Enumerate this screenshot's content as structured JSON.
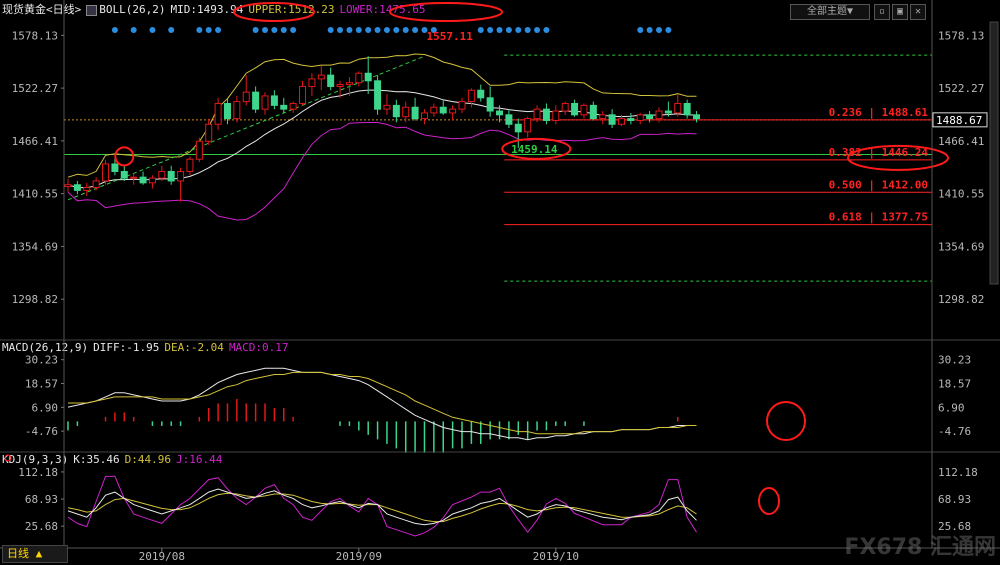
{
  "colors": {
    "bg": "#000000",
    "up": "#e01818",
    "down": "#3dd68c",
    "mid": "#e8e8e8",
    "upper": "#d4c23a",
    "lower": "#cc22cc",
    "diff": "#e8e8e8",
    "dea": "#d4c23a",
    "kdj_k": "#e8e8e8",
    "kdj_d": "#d4c23a",
    "kdj_j": "#cc22cc",
    "fib": "#ff2222",
    "support": "#2ecc40",
    "annot": "#ff1a1a",
    "axis": "#b8b8b8"
  },
  "header": {
    "symbol": "现货黄金",
    "period_tag": "<日线>",
    "indicator_icon": "chart-icon",
    "boll_name": "BOLL(26,2)",
    "mid": "MID:1493.94",
    "upper": "UPPER:1512.23",
    "lower": "LOWER:1475.65"
  },
  "macd_header": {
    "name": "MACD(26,12,9)",
    "diff": "DIFF:-1.95",
    "dea": "DEA:-2.04",
    "macd": "MACD:0.17"
  },
  "kdj_header": {
    "name": "KDJ(9,3,3)",
    "k": "K:35.46",
    "d": "D:44.96",
    "j": "J:16.44"
  },
  "toolbar": {
    "theme_label": "全部主题▼"
  },
  "period_button": "日线 ▲",
  "watermark": "FX678 汇通网",
  "chart_data": [
    {
      "type": "candlestick",
      "title": "现货黄金 <日线>",
      "y_ticks": [
        "1578.13",
        "1522.27",
        "1466.41",
        "1410.55",
        "1354.69",
        "1298.82"
      ],
      "ylim": [
        1262.0,
        1588.0
      ],
      "x_labels": [
        {
          "label": "2019/08",
          "index": 10
        },
        {
          "label": "2019/09",
          "index": 31
        },
        {
          "label": "2019/10",
          "index": 52
        }
      ],
      "ohlc": [
        [
          1418,
          1426,
          1412,
          1420
        ],
        [
          1420,
          1424,
          1410,
          1414
        ],
        [
          1414,
          1422,
          1408,
          1417
        ],
        [
          1417,
          1428,
          1414,
          1424
        ],
        [
          1424,
          1446,
          1420,
          1442
        ],
        [
          1442,
          1448,
          1430,
          1434
        ],
        [
          1434,
          1440,
          1424,
          1427
        ],
        [
          1427,
          1432,
          1420,
          1428
        ],
        [
          1428,
          1434,
          1420,
          1422
        ],
        [
          1422,
          1430,
          1416,
          1427
        ],
        [
          1427,
          1440,
          1424,
          1434
        ],
        [
          1434,
          1440,
          1420,
          1424
        ],
        [
          1424,
          1438,
          1402,
          1434
        ],
        [
          1434,
          1450,
          1430,
          1447
        ],
        [
          1447,
          1470,
          1444,
          1466
        ],
        [
          1466,
          1490,
          1462,
          1484
        ],
        [
          1484,
          1512,
          1478,
          1506
        ],
        [
          1506,
          1512,
          1484,
          1490
        ],
        [
          1490,
          1514,
          1486,
          1508
        ],
        [
          1508,
          1536,
          1504,
          1518
        ],
        [
          1518,
          1524,
          1496,
          1500
        ],
        [
          1500,
          1518,
          1494,
          1514
        ],
        [
          1514,
          1520,
          1500,
          1504
        ],
        [
          1504,
          1512,
          1496,
          1500
        ],
        [
          1500,
          1508,
          1496,
          1506
        ],
        [
          1506,
          1530,
          1504,
          1524
        ],
        [
          1524,
          1538,
          1514,
          1532
        ],
        [
          1532,
          1546,
          1520,
          1536
        ],
        [
          1536,
          1544,
          1520,
          1524
        ],
        [
          1524,
          1530,
          1512,
          1526
        ],
        [
          1526,
          1534,
          1514,
          1528
        ],
        [
          1528,
          1540,
          1524,
          1538
        ],
        [
          1538,
          1556,
          1516,
          1530
        ],
        [
          1530,
          1536,
          1494,
          1500
        ],
        [
          1500,
          1516,
          1494,
          1504
        ],
        [
          1504,
          1510,
          1486,
          1492
        ],
        [
          1492,
          1508,
          1486,
          1502
        ],
        [
          1502,
          1512,
          1488,
          1490
        ],
        [
          1490,
          1500,
          1484,
          1496
        ],
        [
          1496,
          1506,
          1492,
          1502
        ],
        [
          1502,
          1510,
          1494,
          1496
        ],
        [
          1496,
          1504,
          1488,
          1500
        ],
        [
          1500,
          1512,
          1496,
          1508
        ],
        [
          1508,
          1522,
          1502,
          1520
        ],
        [
          1520,
          1526,
          1508,
          1512
        ],
        [
          1512,
          1524,
          1492,
          1498
        ],
        [
          1498,
          1504,
          1486,
          1494
        ],
        [
          1494,
          1500,
          1480,
          1484
        ],
        [
          1484,
          1490,
          1459,
          1476
        ],
        [
          1476,
          1492,
          1470,
          1490
        ],
        [
          1490,
          1504,
          1486,
          1500
        ],
        [
          1500,
          1506,
          1484,
          1488
        ],
        [
          1488,
          1504,
          1484,
          1498
        ],
        [
          1498,
          1508,
          1494,
          1506
        ],
        [
          1506,
          1510,
          1492,
          1494
        ],
        [
          1494,
          1506,
          1490,
          1504
        ],
        [
          1504,
          1508,
          1488,
          1490
        ],
        [
          1490,
          1498,
          1484,
          1494
        ],
        [
          1494,
          1500,
          1480,
          1484
        ],
        [
          1484,
          1494,
          1482,
          1490
        ],
        [
          1490,
          1496,
          1484,
          1488
        ],
        [
          1488,
          1496,
          1484,
          1494
        ],
        [
          1494,
          1498,
          1486,
          1490
        ],
        [
          1490,
          1502,
          1486,
          1498
        ],
        [
          1498,
          1508,
          1492,
          1496
        ],
        [
          1496,
          1516,
          1492,
          1506
        ],
        [
          1506,
          1510,
          1490,
          1494
        ],
        [
          1494,
          1498,
          1486,
          1490
        ]
      ],
      "annotations": {
        "peak_label": "1557.11",
        "low_label": "1459.14",
        "fib_levels": [
          {
            "ratio": "0.236",
            "price": 1488.61,
            "label": "0.236 | 1488.61"
          },
          {
            "ratio": "0.382",
            "price": 1446.24,
            "label": "0.382 | 1446.24"
          },
          {
            "ratio": "0.500",
            "price": 1412.0,
            "label": "0.500 | 1412.00"
          },
          {
            "ratio": "0.618",
            "price": 1377.75,
            "label": "0.618 | 1377.75"
          }
        ],
        "top_guide": 1557.11,
        "bottom_guide": 1318.0,
        "support": 1452.0,
        "current_price": "1488.67"
      }
    },
    {
      "type": "line",
      "title": "MACD(26,12,9)",
      "y_ticks": [
        "30.23",
        "18.57",
        "6.90",
        "-4.76"
      ],
      "ylim": [
        -14.0,
        34.0
      ],
      "series": [
        {
          "name": "DIFF",
          "values": [
            7,
            8,
            9,
            10,
            12,
            14,
            14,
            13,
            12,
            11,
            10,
            10,
            10,
            11,
            13,
            16,
            19,
            21,
            23,
            24,
            25,
            26,
            26,
            26,
            25,
            24,
            24,
            24,
            23,
            22,
            21,
            20,
            18,
            15,
            12,
            9,
            6,
            3,
            1,
            -1,
            -3,
            -4,
            -5,
            -5,
            -6,
            -6,
            -7,
            -8,
            -8,
            -9,
            -8,
            -8,
            -7,
            -7,
            -6,
            -6,
            -5,
            -5,
            -5,
            -4,
            -4,
            -4,
            -4,
            -3,
            -3,
            -2,
            -2,
            -2
          ]
        },
        {
          "name": "DEA",
          "values": [
            9,
            9,
            9,
            10,
            11,
            12,
            12,
            12,
            12,
            12,
            11,
            11,
            11,
            11,
            12,
            13,
            15,
            17,
            18,
            20,
            21,
            22,
            23,
            23,
            24,
            24,
            24,
            24,
            23,
            23,
            22,
            22,
            21,
            19,
            17,
            15,
            13,
            10,
            8,
            6,
            4,
            2,
            1,
            0,
            -1,
            -2,
            -3,
            -4,
            -5,
            -5,
            -6,
            -6,
            -6,
            -6,
            -6,
            -5,
            -5,
            -5,
            -5,
            -4,
            -4,
            -4,
            -4,
            -3,
            -3,
            -3,
            -2,
            -2
          ]
        },
        {
          "name": "MACD",
          "values": [
            -2,
            -1,
            0,
            0,
            1,
            2,
            2,
            1,
            0,
            -1,
            -1,
            -1,
            -1,
            0,
            1,
            3,
            4,
            4,
            5,
            4,
            4,
            4,
            3,
            3,
            1,
            0,
            0,
            0,
            0,
            -1,
            -1,
            -2,
            -3,
            -4,
            -5,
            -6,
            -7,
            -7,
            -7,
            -7,
            -7,
            -6,
            -6,
            -5,
            -5,
            -4,
            -4,
            -4,
            -3,
            -4,
            -2,
            -2,
            -1,
            -1,
            0,
            -1,
            0,
            0,
            0,
            0,
            0,
            0,
            0,
            0,
            0,
            1,
            0,
            0
          ]
        }
      ]
    },
    {
      "type": "line",
      "title": "KDJ(9,3,3)",
      "y_ticks": [
        "112.18",
        "68.93",
        "25.68"
      ],
      "ylim": [
        -6.0,
        128.0
      ],
      "series": [
        {
          "name": "K",
          "values": [
            50,
            45,
            40,
            55,
            75,
            80,
            70,
            60,
            55,
            50,
            45,
            50,
            55,
            60,
            70,
            80,
            85,
            80,
            75,
            70,
            72,
            78,
            82,
            75,
            70,
            60,
            55,
            58,
            62,
            65,
            60,
            55,
            62,
            60,
            45,
            40,
            35,
            30,
            28,
            30,
            35,
            45,
            50,
            55,
            62,
            65,
            70,
            60,
            50,
            40,
            45,
            55,
            60,
            58,
            52,
            48,
            44,
            40,
            38,
            36,
            40,
            42,
            44,
            50,
            68,
            72,
            50,
            35
          ]
        },
        {
          "name": "D",
          "values": [
            55,
            52,
            48,
            50,
            60,
            68,
            70,
            66,
            62,
            58,
            54,
            52,
            52,
            55,
            62,
            70,
            76,
            78,
            77,
            74,
            72,
            74,
            77,
            77,
            75,
            70,
            65,
            62,
            61,
            62,
            61,
            59,
            60,
            60,
            55,
            50,
            45,
            40,
            35,
            33,
            33,
            38,
            42,
            47,
            53,
            58,
            62,
            61,
            57,
            52,
            50,
            52,
            55,
            56,
            55,
            52,
            49,
            46,
            43,
            40,
            40,
            41,
            42,
            45,
            52,
            58,
            55,
            45
          ]
        },
        {
          "name": "J",
          "values": [
            40,
            30,
            25,
            65,
            105,
            105,
            70,
            45,
            40,
            35,
            30,
            45,
            60,
            70,
            85,
            100,
            103,
            85,
            70,
            60,
            72,
            86,
            92,
            70,
            60,
            40,
            35,
            50,
            65,
            70,
            58,
            48,
            70,
            60,
            25,
            20,
            15,
            10,
            15,
            24,
            39,
            60,
            66,
            72,
            80,
            80,
            86,
            58,
            36,
            16,
            35,
            61,
            70,
            62,
            46,
            40,
            34,
            28,
            28,
            28,
            40,
            44,
            48,
            60,
            100,
            100,
            40,
            16
          ]
        }
      ]
    }
  ]
}
